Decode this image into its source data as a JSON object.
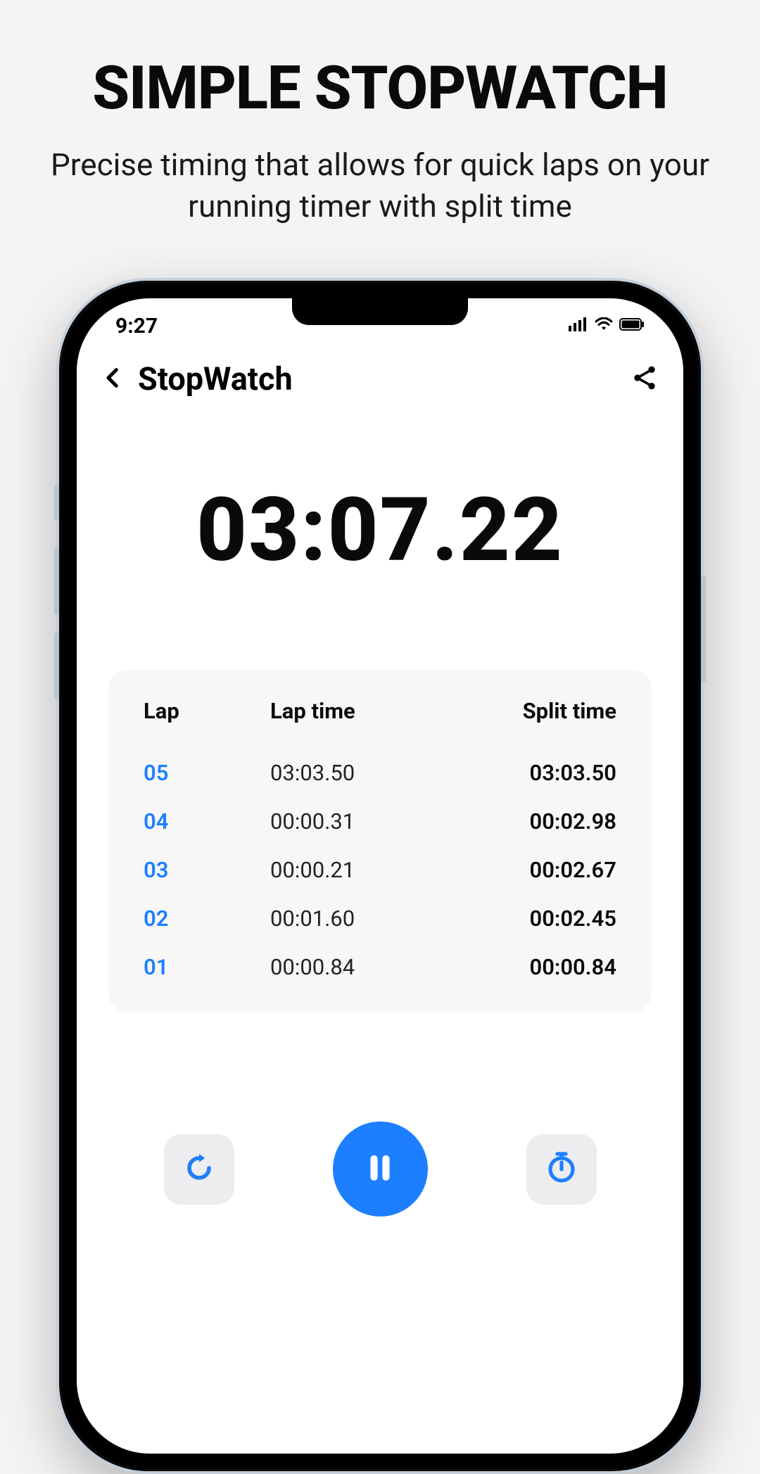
{
  "promo": {
    "title": "SIMPLE STOPWATCH",
    "subtitle": "Precise timing that allows for quick laps on your running timer with split time"
  },
  "status": {
    "time": "9:27"
  },
  "header": {
    "title": "StopWatch"
  },
  "timer": {
    "elapsed": "03:07.22"
  },
  "table": {
    "col_lap": "Lap",
    "col_laptime": "Lap time",
    "col_split": "Split time"
  },
  "laps": [
    {
      "num": "05",
      "lap_time": "03:03.50",
      "split": "03:03.50"
    },
    {
      "num": "04",
      "lap_time": "00:00.31",
      "split": "00:02.98"
    },
    {
      "num": "03",
      "lap_time": "00:00.21",
      "split": "00:02.67"
    },
    {
      "num": "02",
      "lap_time": "00:01.60",
      "split": "00:02.45"
    },
    {
      "num": "01",
      "lap_time": "00:00.84",
      "split": "00:00.84"
    }
  ],
  "colors": {
    "accent": "#1d7fff"
  }
}
